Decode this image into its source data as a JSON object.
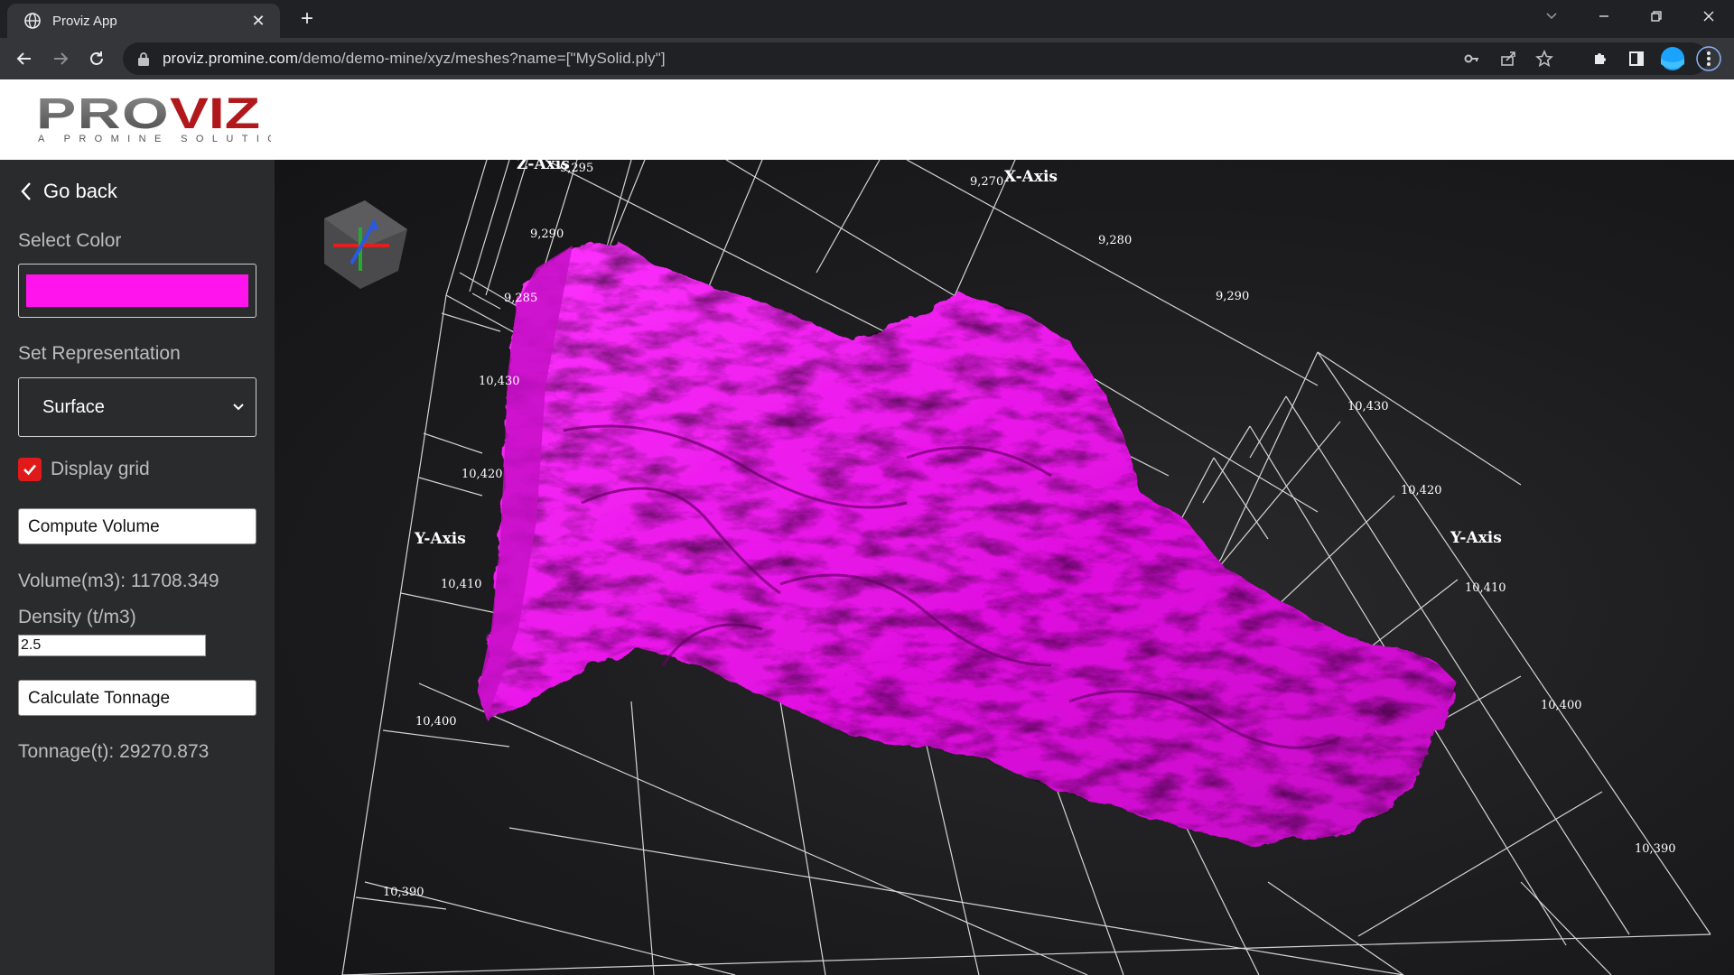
{
  "browser": {
    "tab_title": "Proviz App",
    "url_host": "proviz.promine.com",
    "url_path": "/demo/demo-mine/xyz/meshes?name=[\"MySolid.ply\"]"
  },
  "header": {
    "logo_text": "PROVIZ",
    "logo_tagline": "A PROMINE SOLUTION"
  },
  "sidebar": {
    "go_back": "Go back",
    "select_color_label": "Select Color",
    "selected_color": "#ff14ee",
    "representation_label": "Set Representation",
    "representation_value": "Surface",
    "display_grid_label": "Display grid",
    "display_grid_checked": true,
    "compute_volume_button": "Compute Volume",
    "volume_text": "Volume(m3): 11708.349",
    "density_label": "Density (t/m3)",
    "density_value": "2.5",
    "calculate_tonnage_button": "Calculate Tonnage",
    "tonnage_text": "Tonnage(t): 29270.873"
  },
  "viewport": {
    "axis_titles": {
      "z": "Z-Axis",
      "x": "X-Axis",
      "y_left": "Y-Axis",
      "y_right": "Y-Axis"
    },
    "z_ticks": [
      "9,295",
      "9,290",
      "9,285"
    ],
    "x_ticks": [
      "9,270",
      "9,280",
      "9,290"
    ],
    "y_left_ticks": [
      "10,430",
      "10,420",
      "10,410",
      "10,400",
      "10,390"
    ],
    "y_right_ticks": [
      "10,430",
      "10,420",
      "10,410",
      "10,400",
      "10,390"
    ],
    "mesh_color": "#e012e0"
  }
}
